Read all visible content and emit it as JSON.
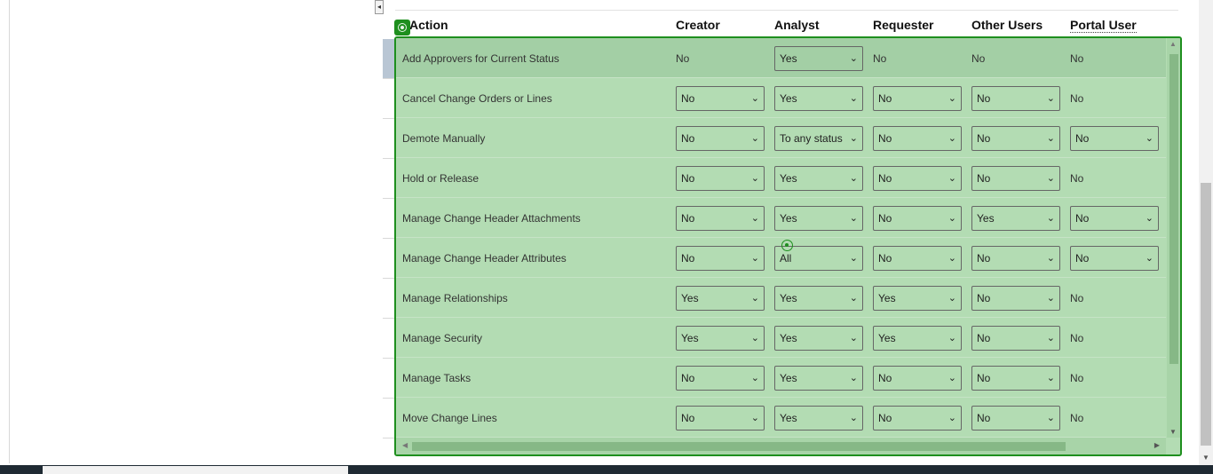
{
  "columns": {
    "action": "Action",
    "creator": "Creator",
    "analyst": "Analyst",
    "requester": "Requester",
    "other": "Other Users",
    "portal": "Portal User"
  },
  "colors": {
    "overlay": "#b3dcb3",
    "highlight_row": "#a3cfa5",
    "border": "#1e8f1e"
  },
  "chevron_glyph": "⌄",
  "rows": [
    {
      "action": "Add Approvers for Current Status",
      "creator": "No",
      "analyst": "Yes",
      "requester": "No",
      "other": "No",
      "portal": "No"
    },
    {
      "action": "Cancel Change Orders or Lines",
      "creator": "No",
      "analyst": "Yes",
      "requester": "No",
      "other": "No",
      "portal": "No"
    },
    {
      "action": "Demote Manually",
      "creator": "No",
      "analyst": "To any status",
      "requester": "No",
      "other": "No",
      "portal": "No"
    },
    {
      "action": "Hold or Release",
      "creator": "No",
      "analyst": "Yes",
      "requester": "No",
      "other": "No",
      "portal": "No"
    },
    {
      "action": "Manage Change Header Attachments",
      "creator": "No",
      "analyst": "Yes",
      "requester": "No",
      "other": "Yes",
      "portal": "No"
    },
    {
      "action": "Manage Change Header Attributes",
      "creator": "No",
      "analyst": "All",
      "requester": "No",
      "other": "No",
      "portal": "No"
    },
    {
      "action": "Manage Relationships",
      "creator": "Yes",
      "analyst": "Yes",
      "requester": "Yes",
      "other": "No",
      "portal": "No"
    },
    {
      "action": "Manage Security",
      "creator": "Yes",
      "analyst": "Yes",
      "requester": "Yes",
      "other": "No",
      "portal": "No"
    },
    {
      "action": "Manage Tasks",
      "creator": "No",
      "analyst": "Yes",
      "requester": "No",
      "other": "No",
      "portal": "No"
    },
    {
      "action": "Move Change Lines",
      "creator": "No",
      "analyst": "Yes",
      "requester": "No",
      "other": "No",
      "portal": "No"
    }
  ]
}
